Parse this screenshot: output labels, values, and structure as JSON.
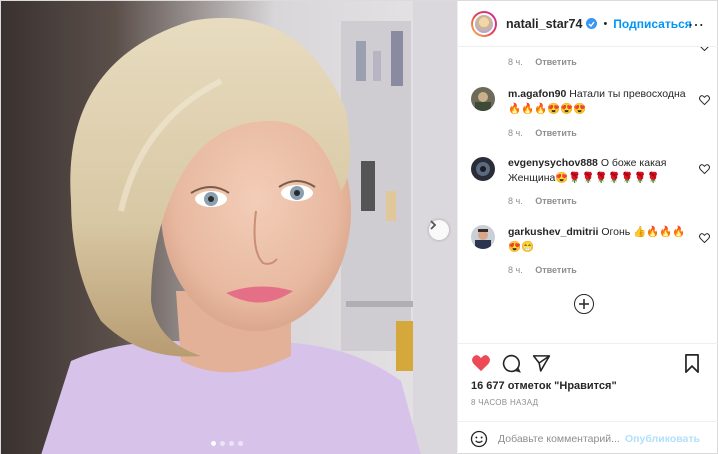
{
  "header": {
    "username": "natali_star74",
    "separator": "•",
    "follow_label": "Подписаться",
    "close_glyph": "⋯"
  },
  "carousel": {
    "slide_count": 4,
    "active_index": 0
  },
  "comments": [
    {
      "meta_time": "8 ч.",
      "reply_label": "Ответить"
    },
    {
      "username": "m.agafon90",
      "text": "Натали ты превосходна 🔥🔥🔥😍😍😍",
      "time": "8 ч.",
      "reply_label": "Ответить"
    },
    {
      "username": "evgenysychov888",
      "text": "О боже какая Женщина😍🌹🌹🌹🌹🌹🌹🌹",
      "time": "8 ч.",
      "reply_label": "Ответить"
    },
    {
      "username": "garkushev_dmitrii",
      "text": "Огонь 👍🔥🔥🔥😍😁",
      "time": "8 ч.",
      "reply_label": "Ответить"
    }
  ],
  "actions": {
    "likes_text": "16 677 отметок \"Нравится\"",
    "time_ago": "8 ЧАСОВ НАЗАД"
  },
  "add_comment": {
    "placeholder": "Добавьте комментарий...",
    "publish_label": "Опубликовать"
  },
  "colors": {
    "link_blue": "#0095f6",
    "like_red": "#ed4956",
    "muted": "#8e8e8e"
  },
  "icons": [
    "chevron-right-icon",
    "verified-icon",
    "more-icon",
    "heart-icon",
    "comment-icon",
    "share-icon",
    "bookmark-icon",
    "plus-circle-icon",
    "emoji-icon"
  ]
}
